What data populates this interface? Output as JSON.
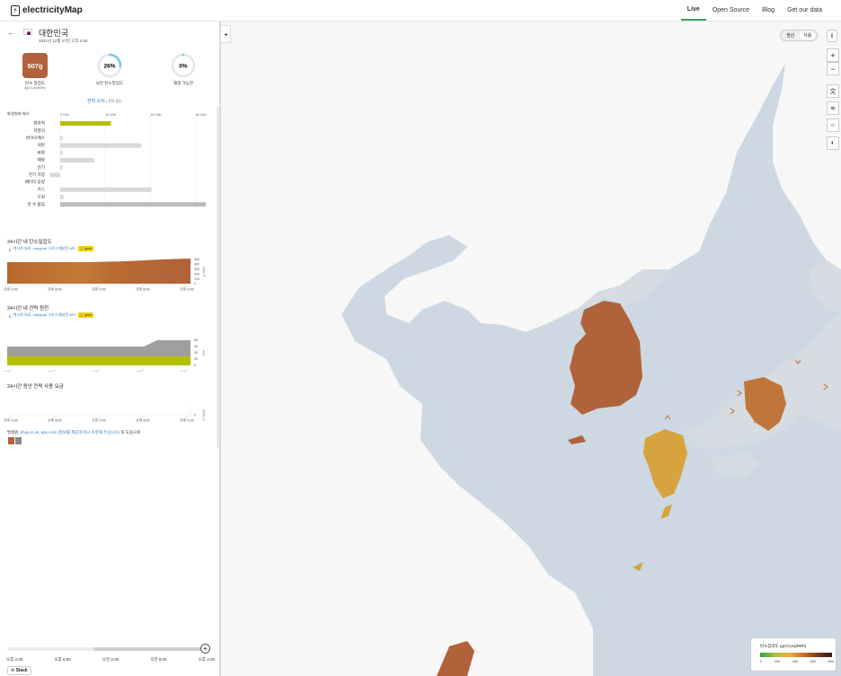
{
  "nav": {
    "brand": "electricityMap",
    "links": [
      "Live",
      "Open Source",
      "Blog",
      "Get our data"
    ],
    "active": "Live"
  },
  "panel": {
    "back_icon": "arrow-left-icon",
    "zone_name": "대한민국",
    "date": "2021년 12월 27일 오후 2:00",
    "kpi": {
      "carbon_value": "507",
      "carbon_unit": "g",
      "carbon_label": "탄소 밀집도",
      "carbon_sublabel": "(gCO₂eq/kWh)",
      "low_carbon_pct": "26%",
      "low_carbon_fraction": 0.26,
      "low_carbon_label": "낮은 탄소밀집도",
      "renewable_pct": "0%",
      "renewable_fraction": 0.0,
      "renewable_label": "재생 가능한"
    },
    "mode_link": "전력 소비",
    "mode_alt": "| 전력 생산",
    "breakdown": {
      "header_label": "발생원에 따라",
      "axis_ticks": [
        "0 GW",
        "20 GW",
        "40 GW",
        "60 GW"
      ],
      "sources": [
        {
          "label": "원자력",
          "value": 22.5,
          "color": "#b5c000"
        },
        {
          "label": "지열의",
          "value": 0.0,
          "color": "#d8d8d8"
        },
        {
          "label": "바이오매스",
          "value": 1.0,
          "color": "#d8d8d8"
        },
        {
          "label": "석탄",
          "value": 36.0,
          "color": "#d8d8d8"
        },
        {
          "label": "바람",
          "value": 1.0,
          "color": "#d8d8d8"
        },
        {
          "label": "태양",
          "value": 15.0,
          "color": "#d8d8d8"
        },
        {
          "label": "전기",
          "value": 1.0,
          "color": "#d8d8d8"
        },
        {
          "label": "전기 저장",
          "value": -4.5,
          "color": "#d8d8d8"
        },
        {
          "label": "배터리 용량",
          "value": 0.0,
          "color": "#d8d8d8"
        },
        {
          "label": "가스",
          "value": 40.5,
          "color": "#d8d8d8"
        },
        {
          "label": "오일",
          "value": 1.5,
          "color": "#d8d8d8"
        },
        {
          "label": "알 수 없음",
          "value": 64.5,
          "color": "#bbbbbb"
        }
      ]
    },
    "carbon_chart": {
      "title": "24시간 내 탄소밀집도",
      "source_text": "역사적 자료, marginal 그리고 예상된 API",
      "badge": "gene",
      "y_ticks": [
        "500",
        "400",
        "300",
        "200",
        "100",
        "0"
      ],
      "y_unit": "g / kWh",
      "x_ticks": [
        "오후 2:00",
        "오후 8:00",
        "오전 2:00",
        "오전 8:00",
        "오후 2:00"
      ]
    },
    "power_chart": {
      "title": "24시간 내 전력 원천",
      "source_text": "역사적 자료, marginal 그리고 예상된 API",
      "badge": "gene",
      "y_ticks": [
        "80",
        "60",
        "40",
        "20",
        "0"
      ],
      "y_unit": "GW",
      "x_ticks": [
        "오후 2:00",
        "오후 8:00",
        "오전 2:00",
        "오전 8:00",
        "오후 2:00"
      ]
    },
    "price_chart": {
      "title": "24시간 동안 전력 사용 요금",
      "y_ticks": [
        "0"
      ],
      "y_unit": "€ / MWh",
      "x_ticks": [
        "오후 2:00",
        "오후 8:00",
        "오전 2:00",
        "오전 8:00",
        "오후 2:00"
      ]
    },
    "sources_line": {
      "prefix": "발생원: ",
      "links": "khnp.co.kr, kpx.or.kr (정보를 제공하거나 수정해 주십시오)",
      "suffix": " 의 도움으로"
    },
    "timeline": {
      "labels": [
        "오후 2:00",
        "오후 8:00",
        "오전 2:00",
        "오전 8:00",
        "오후 2:00"
      ],
      "play_icon": "plus-icon"
    },
    "slack_label": "Slack"
  },
  "map": {
    "toggle": [
      "생산",
      "사용"
    ],
    "toggle_selected": "사용",
    "info_icon": "info-icon",
    "zoom_in": "+",
    "zoom_out": "−",
    "side_buttons": [
      "translate-icon",
      "wind-icon",
      "sun-icon",
      "dark-mode-icon"
    ],
    "legend": {
      "title": "탄소집약도 (gCO₂eq/kWh)",
      "ticks": [
        "0",
        "200",
        "400",
        "600",
        "800"
      ]
    },
    "colors": {
      "sea": "#cdd8e2",
      "land": "#f7f7f7",
      "no_data_land": "#d8dde3",
      "korea": "#b0623a",
      "kyushu": "#d6a33e",
      "honshu_west": "#c0763a"
    }
  }
}
